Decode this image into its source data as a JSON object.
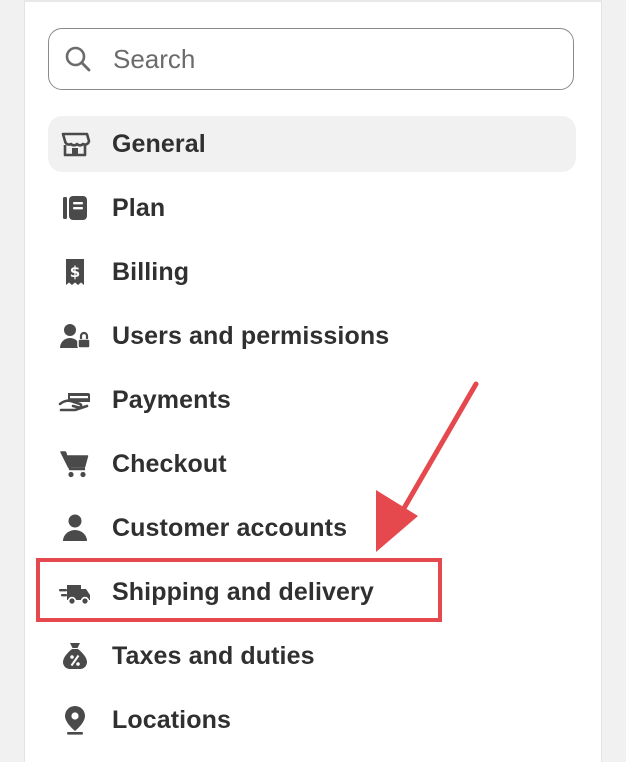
{
  "search": {
    "placeholder": "Search",
    "icon": "search-icon"
  },
  "nav": {
    "items": [
      {
        "label": "General",
        "icon": "store-icon",
        "active": true
      },
      {
        "label": "Plan",
        "icon": "plan-icon"
      },
      {
        "label": "Billing",
        "icon": "billing-receipt-icon"
      },
      {
        "label": "Users and permissions",
        "icon": "users-lock-icon"
      },
      {
        "label": "Payments",
        "icon": "payments-hand-card-icon"
      },
      {
        "label": "Checkout",
        "icon": "cart-icon"
      },
      {
        "label": "Customer accounts",
        "icon": "person-icon"
      },
      {
        "label": "Shipping and delivery",
        "icon": "delivery-truck-icon",
        "highlighted": true
      },
      {
        "label": "Taxes and duties",
        "icon": "tax-bag-icon"
      },
      {
        "label": "Locations",
        "icon": "location-pin-icon"
      }
    ]
  },
  "colors": {
    "text": "#303030",
    "active_bg": "#f1f1f1",
    "annotation": "#e5484d",
    "icon": "#4a4a4a"
  }
}
